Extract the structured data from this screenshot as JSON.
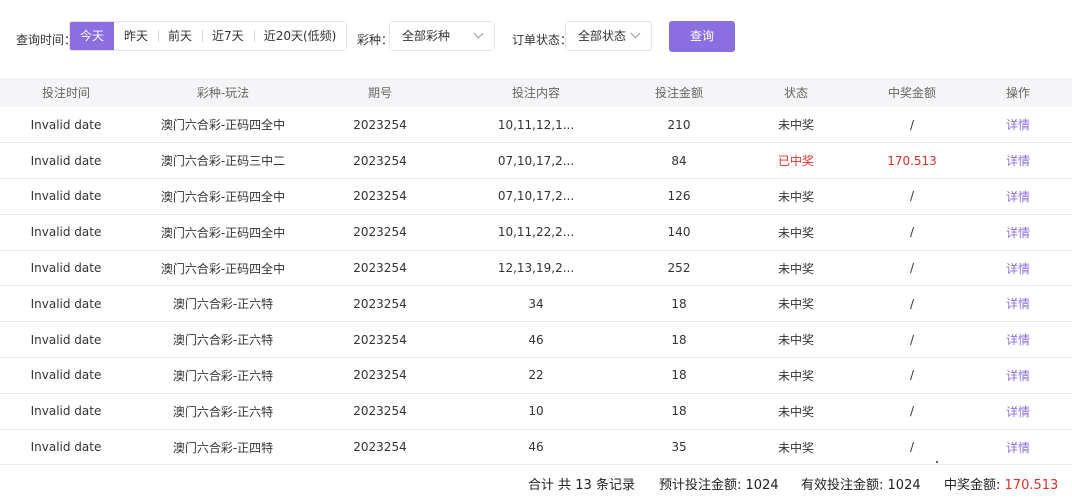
{
  "filters": {
    "time_label": "查询时间：",
    "time_options": [
      "今天",
      "昨天",
      "前天",
      "近7天",
      "近20天(低频)"
    ],
    "time_selected": 0,
    "lottery_label": "彩种：",
    "lottery_value": "全部彩种",
    "status_label": "订单状态：",
    "status_value": "全部状态",
    "query_button": "查询"
  },
  "table": {
    "columns": [
      "投注时间",
      "彩种-玩法",
      "期号",
      "投注内容",
      "投注金额",
      "状态",
      "中奖金额",
      "操作"
    ],
    "rows": [
      {
        "time": "Invalid date",
        "game": "澳门六合彩-正码四全中",
        "period": "2023254",
        "content": "10,11,12,1...",
        "amount": "210",
        "status": "未中奖",
        "prize": "/",
        "action": "详情",
        "won": false
      },
      {
        "time": "Invalid date",
        "game": "澳门六合彩-正码三中二",
        "period": "2023254",
        "content": "07,10,17,2...",
        "amount": "84",
        "status": "已中奖",
        "prize": "170.513",
        "action": "详情",
        "won": true
      },
      {
        "time": "Invalid date",
        "game": "澳门六合彩-正码四全中",
        "period": "2023254",
        "content": "07,10,17,2...",
        "amount": "126",
        "status": "未中奖",
        "prize": "/",
        "action": "详情",
        "won": false
      },
      {
        "time": "Invalid date",
        "game": "澳门六合彩-正码四全中",
        "period": "2023254",
        "content": "10,11,22,2...",
        "amount": "140",
        "status": "未中奖",
        "prize": "/",
        "action": "详情",
        "won": false
      },
      {
        "time": "Invalid date",
        "game": "澳门六合彩-正码四全中",
        "period": "2023254",
        "content": "12,13,19,2...",
        "amount": "252",
        "status": "未中奖",
        "prize": "/",
        "action": "详情",
        "won": false
      },
      {
        "time": "Invalid date",
        "game": "澳门六合彩-正六特",
        "period": "2023254",
        "content": "34",
        "amount": "18",
        "status": "未中奖",
        "prize": "/",
        "action": "详情",
        "won": false
      },
      {
        "time": "Invalid date",
        "game": "澳门六合彩-正六特",
        "period": "2023254",
        "content": "46",
        "amount": "18",
        "status": "未中奖",
        "prize": "/",
        "action": "详情",
        "won": false
      },
      {
        "time": "Invalid date",
        "game": "澳门六合彩-正六特",
        "period": "2023254",
        "content": "22",
        "amount": "18",
        "status": "未中奖",
        "prize": "/",
        "action": "详情",
        "won": false
      },
      {
        "time": "Invalid date",
        "game": "澳门六合彩-正六特",
        "period": "2023254",
        "content": "10",
        "amount": "18",
        "status": "未中奖",
        "prize": "/",
        "action": "详情",
        "won": false
      },
      {
        "time": "Invalid date",
        "game": "澳门六合彩-正四特",
        "period": "2023254",
        "content": "46",
        "amount": "35",
        "status": "未中奖",
        "prize": "/",
        "action": "详情",
        "won": false
      }
    ]
  },
  "summary": {
    "count": "合计 共 13 条记录",
    "expected_label": "预计投注金额:",
    "expected_value": "1024",
    "valid_label": "有效投注金额:",
    "valid_value": "1024",
    "prize_label": "中奖金额:",
    "prize_value": "170.513"
  },
  "colors": {
    "accent": "#8b6fe0",
    "win": "#d9332a",
    "header_bg": "#f5f5f7"
  }
}
